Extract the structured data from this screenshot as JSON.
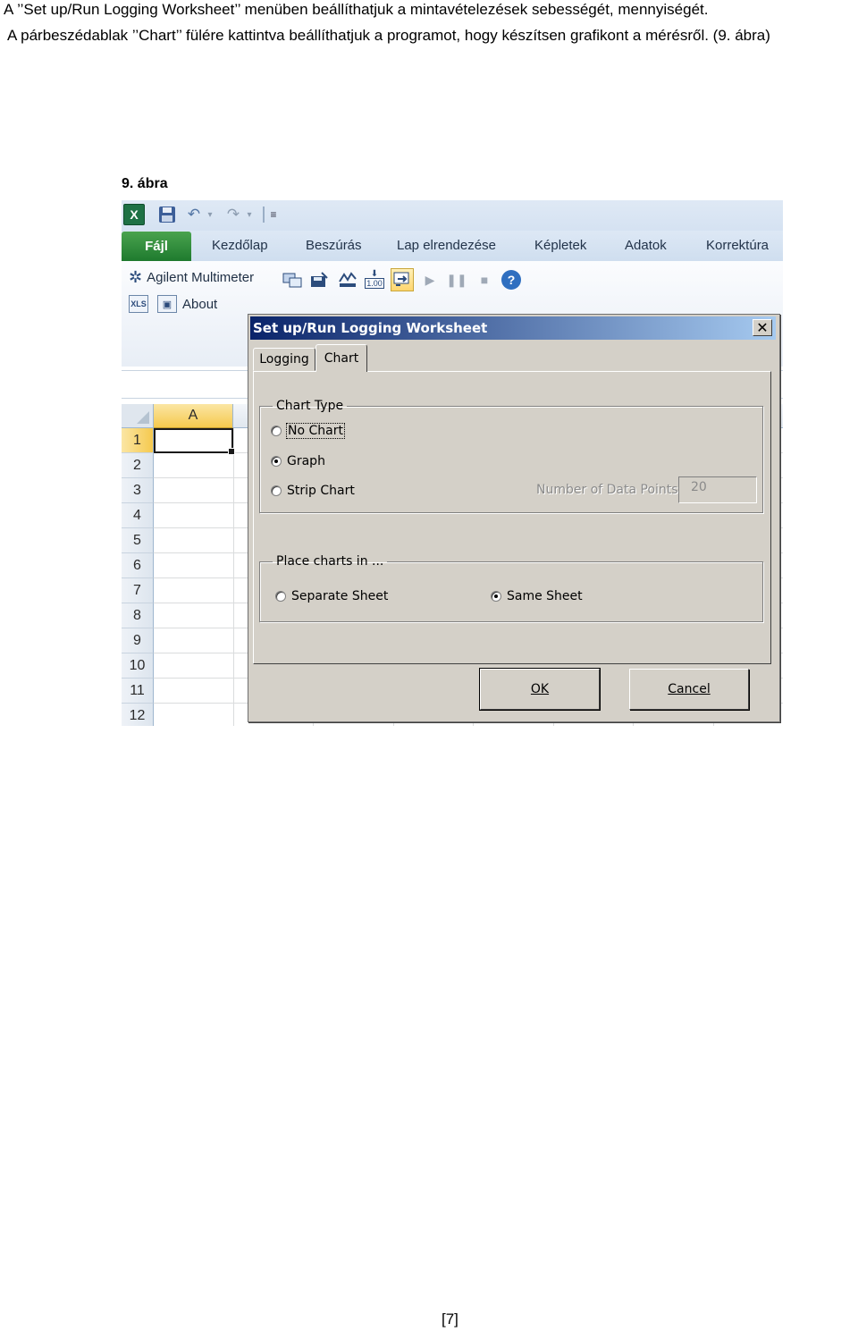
{
  "document": {
    "paragraph1": "A ’’Set up/Run Logging Worksheet’’ menüben beállíthatjuk a mintavételezések sebességét, mennyiségét.",
    "paragraph2": "A párbeszédablak ’’Chart’’ fülére kattintva beállíthatjuk a programot, hogy készítsen grafikont a mérésről. (9. ábra)",
    "caption": "9. ábra",
    "page_number": "[7]"
  },
  "excel": {
    "app_icon_label": "X",
    "quick_access": {
      "icons": [
        "excel-logo-icon",
        "save-icon",
        "undo-icon",
        "redo-icon",
        "customize-icon"
      ]
    },
    "tabs": [
      "Kezdőlap",
      "Beszúrás",
      "Lap elrendezése",
      "Képletek",
      "Adatok",
      "Korrektúra"
    ],
    "file_tab": "Fájl",
    "ribbon": {
      "agilent_label": "Agilent Multimeter",
      "about_label": "About",
      "xls_icon_label": "XLS",
      "display_icon_text": "1.00",
      "help_icon_text": "?"
    },
    "grid": {
      "column_header": "A",
      "rows": [
        "1",
        "2",
        "3",
        "4",
        "5",
        "6",
        "7",
        "8",
        "9",
        "10",
        "11",
        "12"
      ]
    }
  },
  "dialog": {
    "title": "Set up/Run Logging Worksheet",
    "close_symbol": "✕",
    "tabs": {
      "logging": "Logging",
      "chart": "Chart"
    },
    "active_tab": "Chart",
    "chart_type": {
      "legend": "Chart Type",
      "options": {
        "no_chart": "No Chart",
        "graph": "Graph",
        "strip_chart": "Strip Chart"
      },
      "selected": "Graph"
    },
    "data_points": {
      "label": "Number of Data Points",
      "value": "20",
      "enabled": false
    },
    "place_charts": {
      "legend": "Place charts in ...",
      "options": {
        "separate": "Separate Sheet",
        "same": "Same Sheet"
      },
      "selected": "Same Sheet"
    },
    "buttons": {
      "ok": "OK",
      "cancel": "Cancel"
    }
  }
}
